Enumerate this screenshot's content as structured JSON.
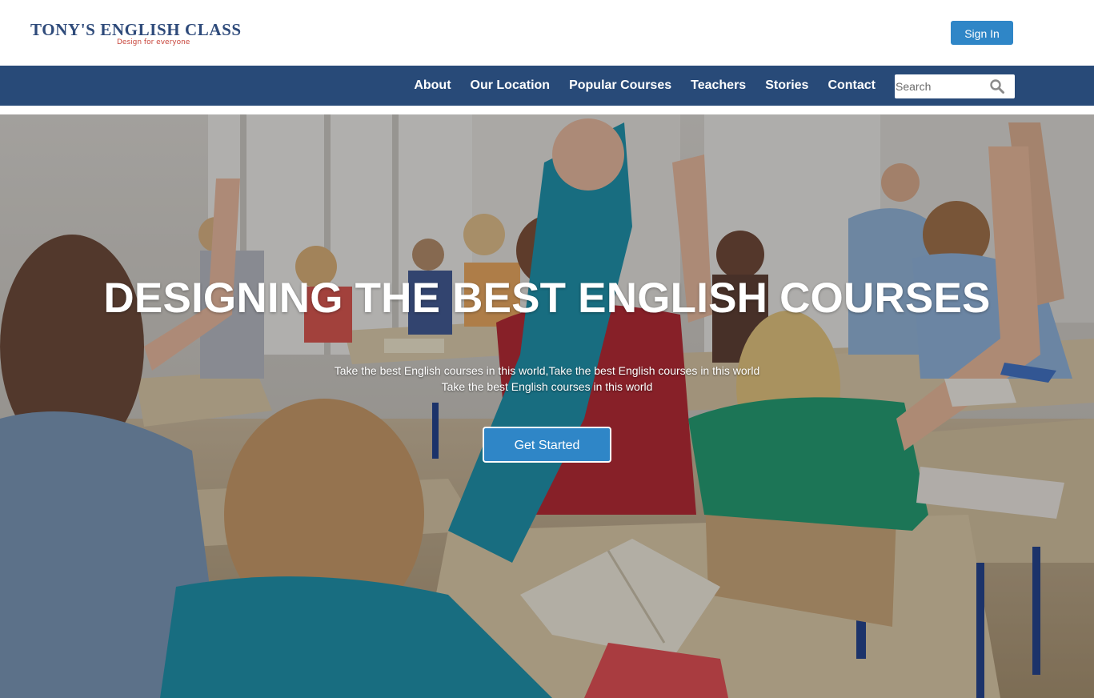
{
  "brand": {
    "title": "TONY'S ENGLISH CLASS",
    "tagline": "Design for everyone"
  },
  "header": {
    "signin_label": "Sign In"
  },
  "nav": {
    "items": [
      {
        "label": "About"
      },
      {
        "label": "Our Location"
      },
      {
        "label": "Popular Courses"
      },
      {
        "label": "Teachers"
      },
      {
        "label": "Stories"
      },
      {
        "label": "Contact"
      }
    ],
    "search_placeholder": "Search"
  },
  "hero": {
    "title": "DESIGNING THE BEST ENGLISH COURSES",
    "subtitle_line1": "Take the best English courses in this world,Take the best English courses in this world",
    "subtitle_line2": "Take the best English courses in this world",
    "cta_label": "Get Started"
  },
  "colors": {
    "nav_background": "#284a78",
    "button_blue": "#2f86c7",
    "logo_navy": "#2e4a7a",
    "tagline_red": "#c8463c"
  },
  "icons": {
    "search": "search-icon"
  }
}
